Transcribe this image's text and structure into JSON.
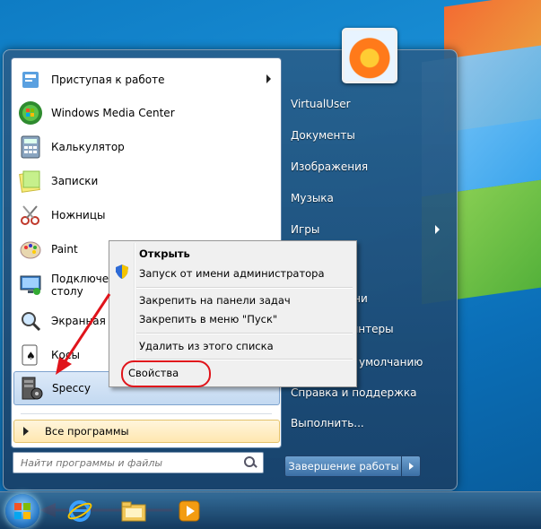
{
  "start_menu": {
    "programs": [
      {
        "label": "Приступая к работе",
        "icon": "getting-started-icon",
        "submenu": true
      },
      {
        "label": "Windows Media Center",
        "icon": "media-center-icon",
        "submenu": false
      },
      {
        "label": "Калькулятор",
        "icon": "calculator-icon",
        "submenu": false
      },
      {
        "label": "Записки",
        "icon": "sticky-notes-icon",
        "submenu": false
      },
      {
        "label": "Ножницы",
        "icon": "scissors-icon",
        "submenu": false
      },
      {
        "label": "Paint",
        "icon": "paint-icon",
        "submenu": false
      },
      {
        "label": "Подключение к удаленному рабочему столу",
        "label_line2": "столу",
        "icon": "remote-desktop-icon",
        "submenu": false
      },
      {
        "label": "Экранная лупа",
        "icon": "magnifier-icon",
        "submenu": false
      },
      {
        "label": "Косынка",
        "icon": "solitaire-icon",
        "submenu": false
      },
      {
        "label": "Speccy",
        "icon": "speccy-icon",
        "submenu": false
      }
    ],
    "program_labels_visible": [
      "Приступая к работе",
      "Windows Media Center",
      "Калькулятор",
      "Записки",
      "Ножницы",
      "Paint",
      "Подключени",
      "Экранная",
      "Косы",
      "Speccy"
    ],
    "remote_desktop_line2": "столу",
    "all_programs_label": "Все программы",
    "search_placeholder": "Найти программы и файлы",
    "right_items": [
      {
        "label": "VirtualUser",
        "submenu": false
      },
      {
        "label": "Документы",
        "submenu": false
      },
      {
        "label": "Изображения",
        "submenu": false
      },
      {
        "label": "Музыка",
        "submenu": false
      },
      {
        "label": "Игры",
        "submenu": true
      },
      {
        "label": "влени",
        "submenu": false
      },
      {
        "label": "принтеры",
        "submenu": false
      },
      {
        "label": "по умолчанию",
        "submenu": false
      },
      {
        "label": "Справка и поддержка",
        "submenu": false
      },
      {
        "label": "Выполнить...",
        "submenu": false
      }
    ],
    "shutdown_label": "Завершение работы"
  },
  "context_menu": {
    "items": [
      {
        "label": "Открыть",
        "bold": true
      },
      {
        "label": "Запуск от имени администратора",
        "icon": "shield-icon"
      },
      {
        "label": "Закрепить на панели задач"
      },
      {
        "label": "Закрепить в меню \"Пуск\""
      },
      {
        "label": "Удалить из этого списка"
      },
      {
        "label": "Свойства",
        "highlighted": true
      }
    ]
  },
  "annotations": {
    "color": "#e0141b"
  },
  "taskbar": {
    "buttons": [
      "start-button",
      "internet-explorer",
      "file-explorer",
      "media-player"
    ]
  }
}
